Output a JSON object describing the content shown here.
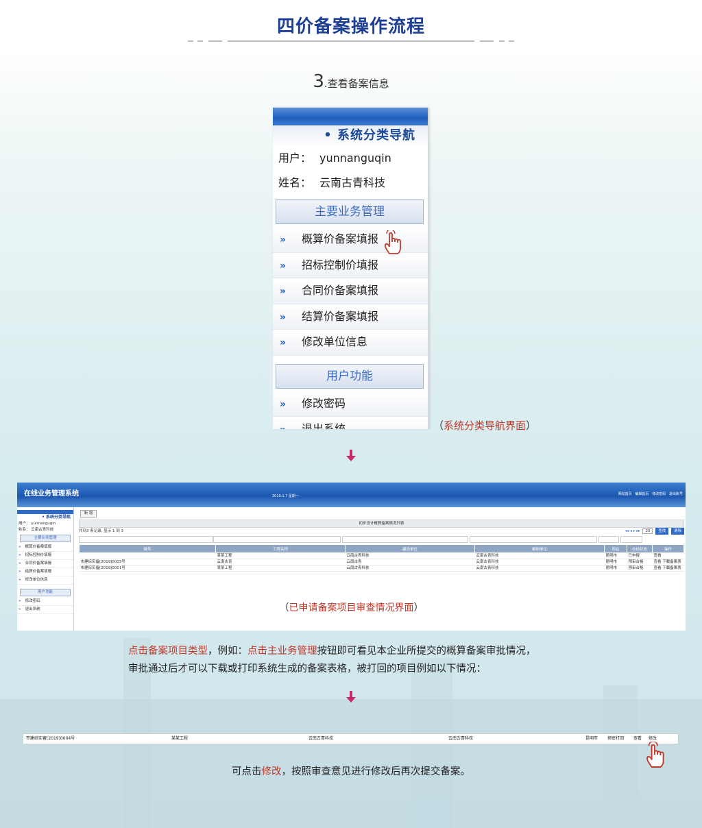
{
  "header": {
    "title": "四价备案操作流程",
    "step_number": "3",
    "step_text": ".查看备案信息"
  },
  "nav_panel": {
    "heading": "• 系统分类导航",
    "user_label": "用户：",
    "user_value": "yunnanguqin",
    "name_label": "姓名：",
    "name_value": "云南古青科技",
    "group_main": "主要业务管理",
    "main_items": [
      "概算价备案填报",
      "招标控制价填报",
      "合同价备案填报",
      "结算价备案填报",
      "修改单位信息"
    ],
    "group_user": "用户功能",
    "user_items": [
      "修改密码",
      "退出系统"
    ],
    "arrow_glyph": "»",
    "caption_open": "（",
    "caption_text": "系统分类导航界面",
    "caption_close": "）"
  },
  "screenshot": {
    "app_title": "在线业务管理系统",
    "date_text": "2019.1.7 星期一",
    "top_links": [
      "网站首页",
      "编辑首页",
      "修改密码",
      "退出账号"
    ],
    "side_heading": "• 系统分类导航",
    "side_user": "用户： yunnanguqin",
    "side_name": "姓名： 云南古青科技",
    "side_group_main": "主要业务管理",
    "side_items": [
      "概算价备案填报",
      "招标控制价填报",
      "合同价备案填报",
      "结算价备案填报",
      "修改单位信息"
    ],
    "side_group_user": "用户功能",
    "side_user_items": [
      "修改密码",
      "退出系统"
    ],
    "new_button": "新 增",
    "list_title": "初步设计概算备案情况列表",
    "record_info": "共到3 条记录, 显示 1 到 3",
    "page_size": "20",
    "query_button": "查找",
    "clear_button": "清除",
    "columns": [
      "编号",
      "工程名称",
      "建设单位",
      "编制单位",
      "所在",
      "办结状态",
      "操作"
    ],
    "rows": [
      [
        "",
        "某某工程",
        "云南古青科技",
        "云南古青科技",
        "昆明市",
        "已申报",
        "查看"
      ],
      [
        "市建综实备[2019]0003号",
        "云南古青",
        "云南古青",
        "云南古青科技",
        "昆明市",
        "预审合格",
        "查看  下载备案表"
      ],
      [
        "市建综实备[2019]0001号",
        "某某工程",
        "云南古青科技",
        "云南古青科技",
        "昆明市",
        "预审合格",
        "查看  下载备案表"
      ]
    ],
    "caption_open": "（",
    "caption_text": "已申请备案项目审查情况界面",
    "caption_close": "）"
  },
  "instructions": {
    "p1_red1": "点击备案项目类型",
    "p1_mid": "，例如：",
    "p1_red2": "点击主业务管理",
    "p1_tail": "按钮即可看见本企业所提交的概算备案审批情况，",
    "p2": "审批通过后才可以下载或打印系统生成的备案表格，被打回的项目例如以下情况："
  },
  "rejected_row": {
    "number": "市建综实备[2019]0004号",
    "project": "某某工程",
    "builder": "云南古青科技",
    "editor": "云南古青科技",
    "city": "昆明市",
    "status": "预审打回",
    "view": "查看",
    "modify": "修改"
  },
  "footer": {
    "pre": "可点击",
    "red": "修改",
    "post": "，按照审查意见进行修改后再次提交备案。"
  },
  "colors": {
    "title_blue": "#1d3f95",
    "accent_red": "#c0392b",
    "arrow_pink": "#c72a6a",
    "nav_blue": "#1f5fbf"
  }
}
